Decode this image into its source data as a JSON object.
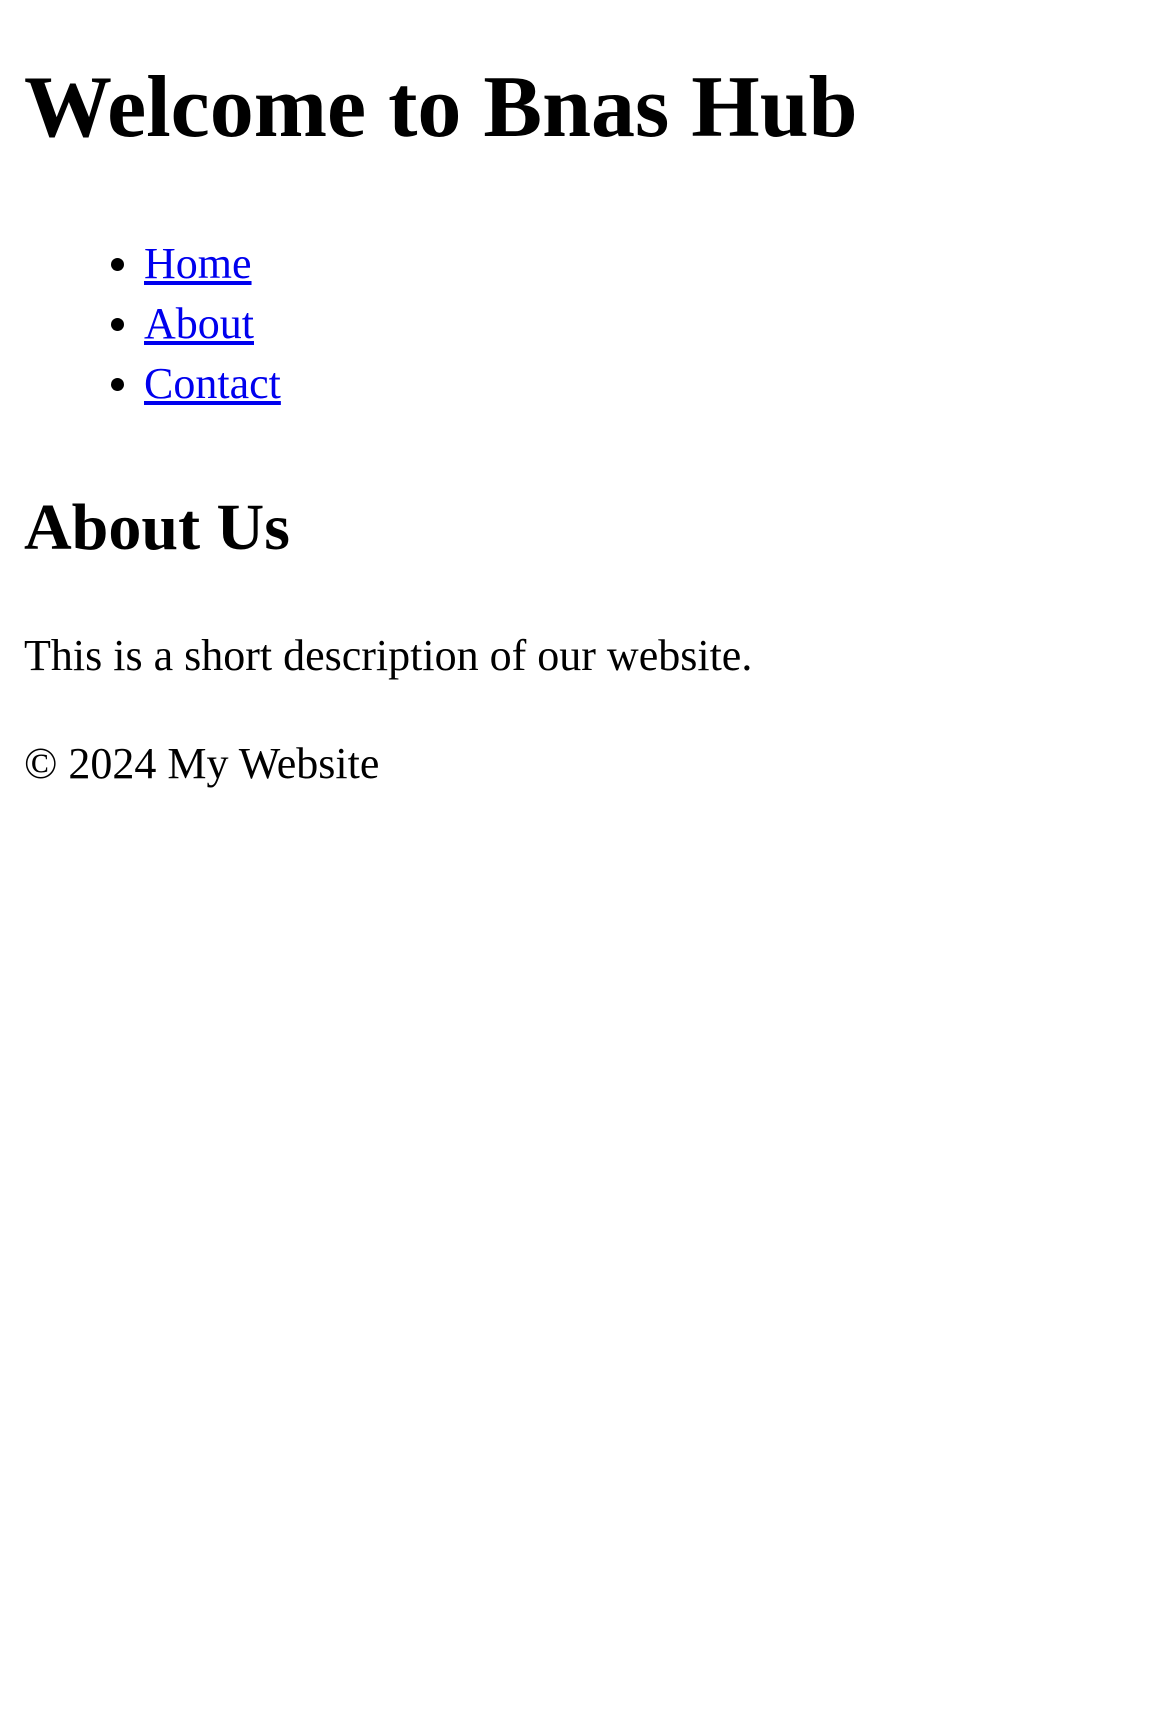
{
  "header": {
    "title": "Welcome to Bnas Hub"
  },
  "nav": {
    "items": [
      {
        "label": "Home"
      },
      {
        "label": "About"
      },
      {
        "label": "Contact"
      }
    ]
  },
  "main": {
    "heading": "About Us",
    "description": "This is a short description of our website."
  },
  "footer": {
    "copyright": "© 2024 My Website"
  },
  "colors": {
    "link": "#0000ee",
    "text": "#000000",
    "background": "#ffffff"
  }
}
